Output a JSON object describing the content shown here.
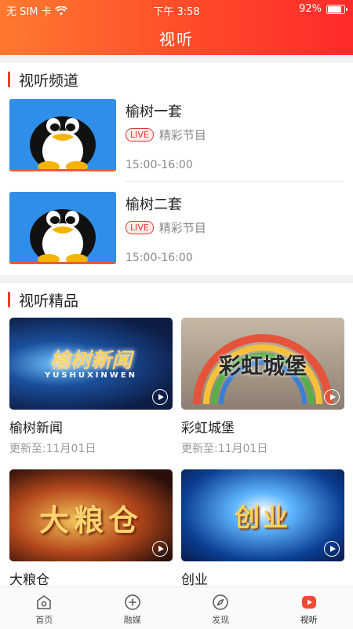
{
  "status_bar": {
    "carrier": "无 SIM 卡",
    "time": "下午 3:58",
    "battery": "92%"
  },
  "header": {
    "title": "视听"
  },
  "channels_section": {
    "title": "视听频道",
    "items": [
      {
        "name": "榆树一套",
        "badge": "LIVE",
        "desc": "精彩节目",
        "time": "15:00-16:00"
      },
      {
        "name": "榆树二套",
        "badge": "LIVE",
        "desc": "精彩节目",
        "time": "15:00-16:00"
      }
    ]
  },
  "featured_section": {
    "title": "视听精品",
    "items": [
      {
        "name": "榆树新闻",
        "updated": "更新至:11月01日",
        "cover_text": "榆树新闻",
        "cover_subtext": "YUSHUXINWEN"
      },
      {
        "name": "彩虹城堡",
        "updated": "更新至:11月01日",
        "cover_text": "彩虹城堡"
      },
      {
        "name": "大粮仓",
        "cover_text": "大粮仓"
      },
      {
        "name": "创业",
        "cover_text": "创业"
      }
    ]
  },
  "tabbar": {
    "items": [
      {
        "label": "首页",
        "icon": "home-icon"
      },
      {
        "label": "融媒",
        "icon": "plus-circle-icon"
      },
      {
        "label": "发现",
        "icon": "compass-icon"
      },
      {
        "label": "视听",
        "icon": "play-icon",
        "active": true
      }
    ]
  },
  "colors": {
    "accent": "#ee3b2f",
    "header_start": "#ff7a2e",
    "header_end": "#ff2a2a"
  }
}
